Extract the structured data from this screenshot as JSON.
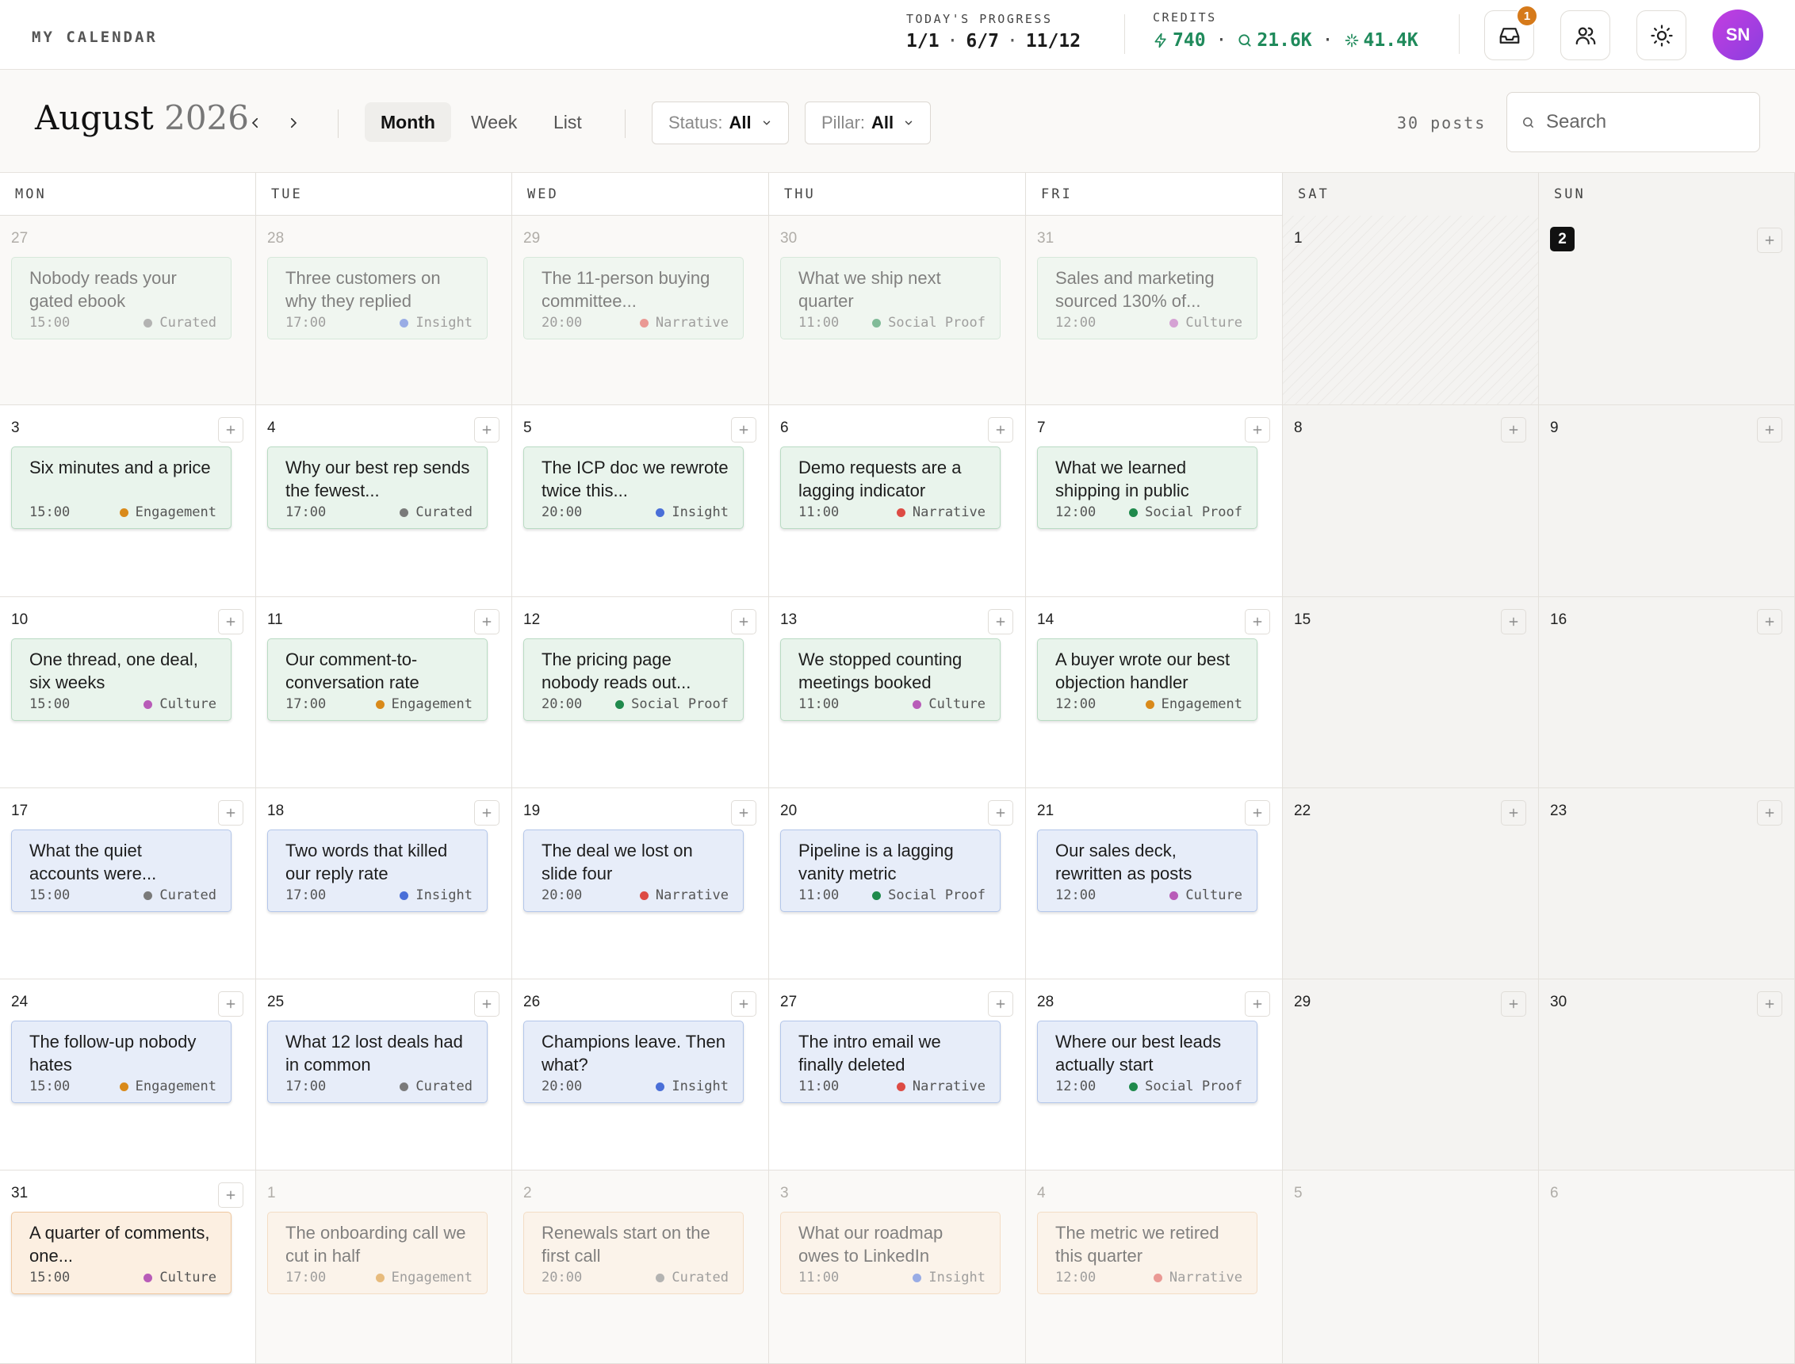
{
  "app": {
    "title": "MY CALENDAR"
  },
  "progress": {
    "label": "TODAY'S PROGRESS",
    "values": [
      "1/1",
      "6/7",
      "11/12"
    ],
    "separator": "·"
  },
  "credits": {
    "label": "CREDITS",
    "bolt": "740",
    "search": "21.6K",
    "sparkle": "41.4K",
    "separator": "·",
    "color": "#1f8a5b"
  },
  "header_icons": {
    "inbox_badge": "1",
    "avatar_initials": "SN"
  },
  "toolbar": {
    "month": "August",
    "year": "2026",
    "views": [
      "Month",
      "Week",
      "List"
    ],
    "active_view": "Month",
    "status_label": "Status:",
    "status_value": "All",
    "pillar_label": "Pillar:",
    "pillar_value": "All",
    "posts_count": "30 posts",
    "search_placeholder": "Search"
  },
  "day_headers": [
    "MON",
    "TUE",
    "WED",
    "THU",
    "FRI",
    "SAT",
    "SUN"
  ],
  "pillar_colors": {
    "Curated": "#7a7a7a",
    "Insight": "#4a6fd8",
    "Narrative": "#dd4b44",
    "Social Proof": "#1f8a4c",
    "Culture": "#b85cb8",
    "Engagement": "#d98a1a"
  },
  "today": "2",
  "weeks": [
    [
      {
        "day": "27",
        "outside": true,
        "post": {
          "title": "Nobody reads your gated ebook",
          "time": "15:00",
          "pillar": "Curated",
          "color": "green"
        }
      },
      {
        "day": "28",
        "outside": true,
        "post": {
          "title": "Three customers on why they replied",
          "time": "17:00",
          "pillar": "Insight",
          "color": "green"
        }
      },
      {
        "day": "29",
        "outside": true,
        "post": {
          "title": "The 11-person buying committee...",
          "time": "20:00",
          "pillar": "Narrative",
          "color": "green"
        }
      },
      {
        "day": "30",
        "outside": true,
        "post": {
          "title": "What we ship next quarter",
          "time": "11:00",
          "pillar": "Social Proof",
          "color": "green"
        }
      },
      {
        "day": "31",
        "outside": true,
        "post": {
          "title": "Sales and marketing sourced 130% of...",
          "time": "12:00",
          "pillar": "Culture",
          "color": "green"
        }
      },
      {
        "day": "1",
        "hatched": true
      },
      {
        "day": "2",
        "today": true,
        "add": true
      }
    ],
    [
      {
        "day": "3",
        "add": true,
        "post": {
          "title": "Six minutes and a price",
          "time": "15:00",
          "pillar": "Engagement",
          "color": "green"
        }
      },
      {
        "day": "4",
        "add": true,
        "post": {
          "title": "Why our best rep sends the fewest...",
          "time": "17:00",
          "pillar": "Curated",
          "color": "green"
        }
      },
      {
        "day": "5",
        "add": true,
        "post": {
          "title": "The ICP doc we rewrote twice this...",
          "time": "20:00",
          "pillar": "Insight",
          "color": "green"
        }
      },
      {
        "day": "6",
        "add": true,
        "post": {
          "title": "Demo requests are a lagging indicator",
          "time": "11:00",
          "pillar": "Narrative",
          "color": "green"
        }
      },
      {
        "day": "7",
        "add": true,
        "post": {
          "title": "What we learned shipping in public",
          "time": "12:00",
          "pillar": "Social Proof",
          "color": "green"
        }
      },
      {
        "day": "8",
        "add": true
      },
      {
        "day": "9",
        "add": true
      }
    ],
    [
      {
        "day": "10",
        "add": true,
        "post": {
          "title": "One thread, one deal, six weeks",
          "time": "15:00",
          "pillar": "Culture",
          "color": "green"
        }
      },
      {
        "day": "11",
        "add": true,
        "post": {
          "title": "Our comment-to-conversation rate",
          "time": "17:00",
          "pillar": "Engagement",
          "color": "green"
        }
      },
      {
        "day": "12",
        "add": true,
        "post": {
          "title": "The pricing page nobody reads out...",
          "time": "20:00",
          "pillar": "Social Proof",
          "color": "green"
        }
      },
      {
        "day": "13",
        "add": true,
        "post": {
          "title": "We stopped counting meetings booked",
          "time": "11:00",
          "pillar": "Culture",
          "color": "green"
        }
      },
      {
        "day": "14",
        "add": true,
        "post": {
          "title": "A buyer wrote our best objection handler",
          "time": "12:00",
          "pillar": "Engagement",
          "color": "green"
        }
      },
      {
        "day": "15",
        "add": true
      },
      {
        "day": "16",
        "add": true
      }
    ],
    [
      {
        "day": "17",
        "add": true,
        "post": {
          "title": "What the quiet accounts were...",
          "time": "15:00",
          "pillar": "Curated",
          "color": "blue"
        }
      },
      {
        "day": "18",
        "add": true,
        "post": {
          "title": "Two words that killed our reply rate",
          "time": "17:00",
          "pillar": "Insight",
          "color": "blue"
        }
      },
      {
        "day": "19",
        "add": true,
        "post": {
          "title": "The deal we lost on slide four",
          "time": "20:00",
          "pillar": "Narrative",
          "color": "blue"
        }
      },
      {
        "day": "20",
        "add": true,
        "post": {
          "title": "Pipeline is a lagging vanity metric",
          "time": "11:00",
          "pillar": "Social Proof",
          "color": "blue"
        }
      },
      {
        "day": "21",
        "add": true,
        "post": {
          "title": "Our sales deck, rewritten as posts",
          "time": "12:00",
          "pillar": "Culture",
          "color": "blue"
        }
      },
      {
        "day": "22",
        "add": true
      },
      {
        "day": "23",
        "add": true
      }
    ],
    [
      {
        "day": "24",
        "add": true,
        "post": {
          "title": "The follow-up nobody hates",
          "time": "15:00",
          "pillar": "Engagement",
          "color": "blue"
        }
      },
      {
        "day": "25",
        "add": true,
        "post": {
          "title": "What 12 lost deals had in common",
          "time": "17:00",
          "pillar": "Curated",
          "color": "blue"
        }
      },
      {
        "day": "26",
        "add": true,
        "post": {
          "title": "Champions leave. Then what?",
          "time": "20:00",
          "pillar": "Insight",
          "color": "blue"
        }
      },
      {
        "day": "27",
        "add": true,
        "post": {
          "title": "The intro email we finally deleted",
          "time": "11:00",
          "pillar": "Narrative",
          "color": "blue"
        }
      },
      {
        "day": "28",
        "add": true,
        "post": {
          "title": "Where our best leads actually start",
          "time": "12:00",
          "pillar": "Social Proof",
          "color": "blue"
        }
      },
      {
        "day": "29",
        "add": true
      },
      {
        "day": "30",
        "add": true
      }
    ],
    [
      {
        "day": "31",
        "add": true,
        "post": {
          "title": "A quarter of comments, one...",
          "time": "15:00",
          "pillar": "Culture",
          "color": "orange"
        }
      },
      {
        "day": "1",
        "outside": true,
        "post": {
          "title": "The onboarding call we cut in half",
          "time": "17:00",
          "pillar": "Engagement",
          "color": "orange"
        }
      },
      {
        "day": "2",
        "outside": true,
        "post": {
          "title": "Renewals start on the first call",
          "time": "20:00",
          "pillar": "Curated",
          "color": "orange"
        }
      },
      {
        "day": "3",
        "outside": true,
        "post": {
          "title": "What our roadmap owes to LinkedIn",
          "time": "11:00",
          "pillar": "Insight",
          "color": "orange"
        }
      },
      {
        "day": "4",
        "outside": true,
        "post": {
          "title": "The metric we retired this quarter",
          "time": "12:00",
          "pillar": "Narrative",
          "color": "orange"
        }
      },
      {
        "day": "5",
        "outside": true
      },
      {
        "day": "6",
        "outside": true
      }
    ]
  ]
}
